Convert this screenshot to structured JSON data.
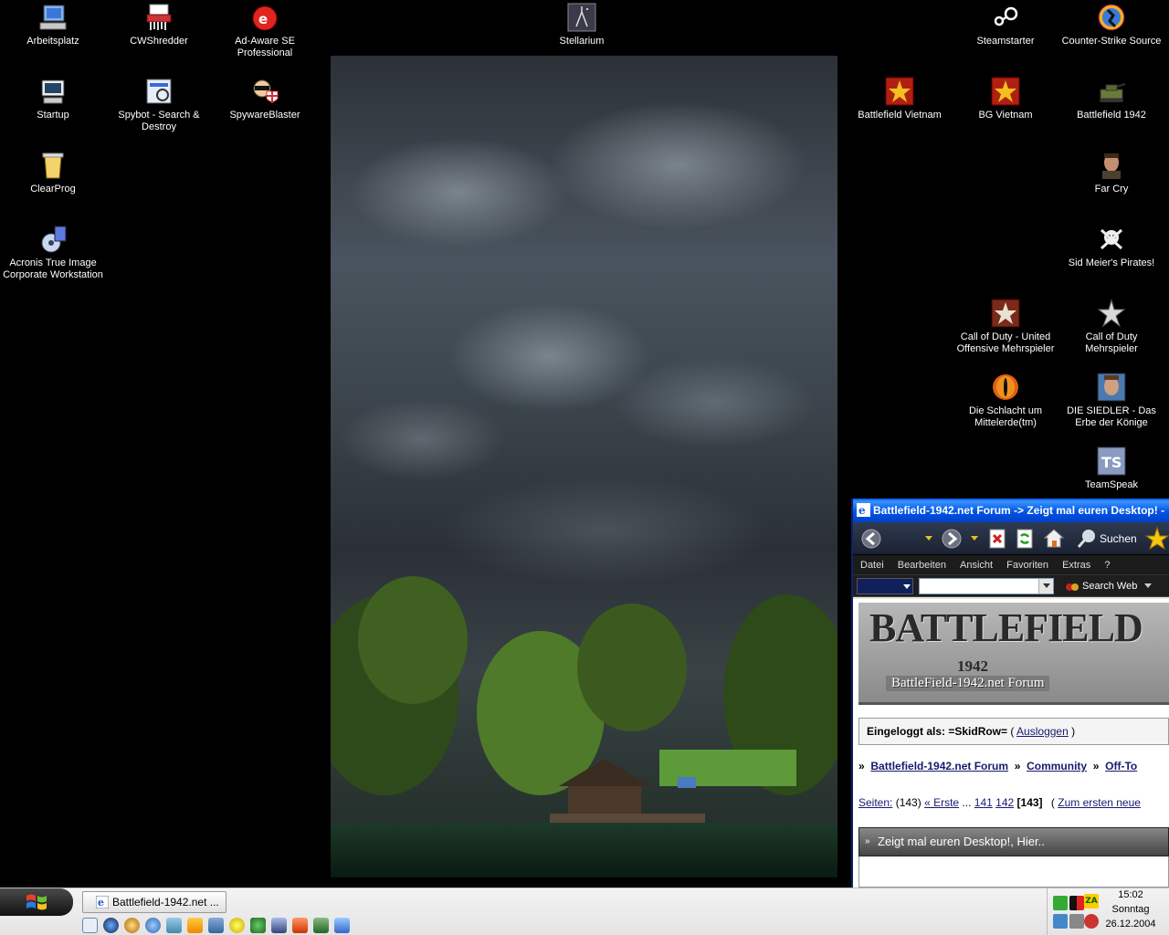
{
  "desktop_icons": [
    {
      "label": "Arbeitsplatz",
      "icon": "computer-icon"
    },
    {
      "label": "CWShredder",
      "icon": "shredder-icon"
    },
    {
      "label": "Ad-Aware SE Professional",
      "icon": "adaware-icon"
    },
    {
      "label": "Stellarium",
      "icon": "stellarium-icon"
    },
    {
      "label": "Steamstarter",
      "icon": "steam-icon"
    },
    {
      "label": "Counter-Strike Source",
      "icon": "counter-strike-icon"
    },
    {
      "label": "Startup",
      "icon": "startup-icon"
    },
    {
      "label": "Spybot - Search & Destroy",
      "icon": "spybot-icon"
    },
    {
      "label": "SpywareBlaster",
      "icon": "spywareblaster-icon"
    },
    {
      "label": "Battlefield Vietnam",
      "icon": "battlefield-vietnam-icon"
    },
    {
      "label": "BG Vietnam",
      "icon": "bg-vietnam-icon"
    },
    {
      "label": "Battlefield 1942",
      "icon": "battlefield-1942-icon"
    },
    {
      "label": "ClearProg",
      "icon": "clearprog-icon"
    },
    {
      "label": "Far Cry",
      "icon": "far-cry-icon"
    },
    {
      "label": "Acronis True Image Corporate Workstation",
      "icon": "acronis-icon"
    },
    {
      "label": "Sid Meier's Pirates!",
      "icon": "pirates-icon"
    },
    {
      "label": "Call of Duty - United Offensive Mehrspieler",
      "icon": "cod-uo-icon"
    },
    {
      "label": "Call of Duty Mehrspieler",
      "icon": "cod-icon"
    },
    {
      "label": "Die Schlacht um Mittelerde(tm)",
      "icon": "mittelerde-icon"
    },
    {
      "label": "DIE SIEDLER - Das Erbe der Könige",
      "icon": "siedler-icon"
    },
    {
      "label": "TeamSpeak",
      "icon": "teamspeak-icon"
    }
  ],
  "ie_window": {
    "title": "Battlefield-1942.net Forum -> Zeigt mal euren Desktop! -",
    "toolbar": {
      "search_label": "Suchen"
    },
    "menu": [
      "Datei",
      "Bearbeiten",
      "Ansicht",
      "Favoriten",
      "Extras",
      "?"
    ],
    "addressbar": {
      "search_web_label": "Search Web"
    },
    "page": {
      "banner_title": "BATTLEFIELD",
      "banner_year": "1942",
      "banner_subtitle": "BattleField-1942.net Forum",
      "login_prefix": "Eingeloggt als: =SkidRow=",
      "login_paren_open": "(",
      "logout_link": "Ausloggen",
      "login_paren_close": ")",
      "breadcrumb": [
        "Battlefield-1942.net Forum",
        "Community",
        "Off-To"
      ],
      "pager_label": "Seiten:",
      "pager_count": "(143)",
      "pager_first": "« Erste",
      "pager_ellipsis": "...",
      "pager_links": [
        "141",
        "142"
      ],
      "pager_current": "[143]",
      "pager_first_unread": "Zum ersten neue",
      "thread_title": "Zeigt mal euren Desktop!, Hier.."
    }
  },
  "taskbar": {
    "task_button_label": "Battlefield-1942.net ...",
    "clock_time": "15:02",
    "clock_day": "Sonntag",
    "clock_date": "26.12.2004"
  }
}
